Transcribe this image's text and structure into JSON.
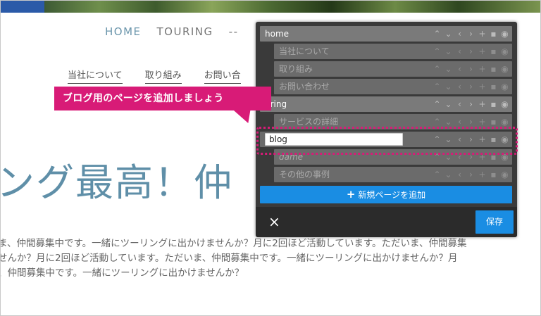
{
  "site": {
    "nav": [
      "HOME",
      "TOURING",
      "--"
    ],
    "subnav": [
      "当社について",
      "取り組み",
      "お問い合"
    ],
    "headline": "ング最高！仲",
    "paragraph_lines": [
      "ま、仲間募集中です。一緒にツーリングに出かけませんか？月に2回ほど活動しています。ただいま、仲間募集",
      "せんか？月に2回ほど活動しています。ただいま、仲間募集中です。一緒にツーリングに出かけませんか？月",
      "、仲間募集中です。一緒にツーリングに出かけませんか？"
    ]
  },
  "callout": {
    "text": "ブログ用のページを追加しましょう"
  },
  "page_manager": {
    "rows": [
      {
        "label": "home",
        "level": "parent"
      },
      {
        "label": "当社について",
        "level": "child"
      },
      {
        "label": "取り組み",
        "level": "child"
      },
      {
        "label": "お問い合わせ",
        "level": "child"
      },
      {
        "label": "uring",
        "level": "parent"
      },
      {
        "label": "サービスの詳細",
        "level": "child"
      },
      {
        "label": "blog",
        "level": "editing"
      },
      {
        "label": "dame",
        "level": "child-italic"
      },
      {
        "label": "その他の事例",
        "level": "child"
      }
    ],
    "new_page_value": "blog",
    "add_button_label": "新規ページを追加",
    "add_icon": "+",
    "close_icon": "×",
    "save_label": "保存"
  },
  "colors": {
    "accent": "#1a8de3",
    "callout": "#d81b77",
    "panel_bg": "#3a3a3a",
    "nav_active": "#6a95ab",
    "headline": "#5f8fa8"
  }
}
